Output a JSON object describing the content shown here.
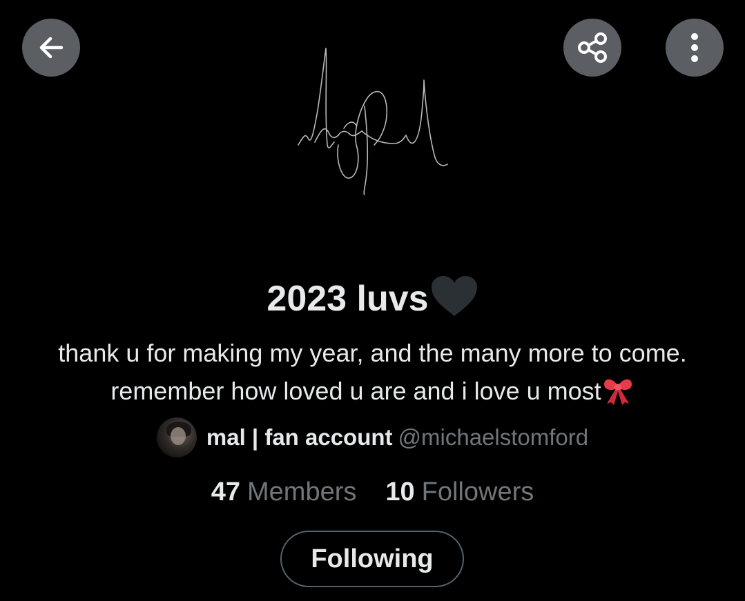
{
  "header": {
    "back_icon": "arrow-left-icon",
    "share_icon": "share-icon",
    "more_icon": "more-vertical-icon",
    "button_color": "#5b5e62"
  },
  "banner": {
    "image": "handwritten-signature",
    "background": "#000000"
  },
  "community": {
    "title": "2023 luvs",
    "title_emoji": "black-heart-icon",
    "description": "thank u for making my year, and the many more to come. remember how loved u are and i love u most",
    "description_emoji": "ribbon-bow-icon"
  },
  "owner": {
    "avatar_icon": "avatar",
    "name": "mal | fan account",
    "handle": "@michaelstomford"
  },
  "stats": {
    "members_count": "47",
    "members_label": "Members",
    "followers_count": "10",
    "followers_label": "Followers"
  },
  "actions": {
    "following_label": "Following"
  },
  "colors": {
    "background": "#000000",
    "primary_text": "#e7e9ea",
    "secondary_text": "#71767b",
    "button_border": "#536471"
  }
}
